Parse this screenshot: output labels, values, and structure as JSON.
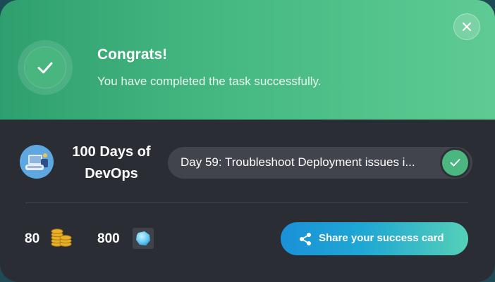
{
  "dialog": {
    "title": "Congrats!",
    "message": "You have completed the task successfully."
  },
  "course": {
    "name": "100 Days of DevOps"
  },
  "task": {
    "label": "Day 59: Troubleshoot Deployment issues i..."
  },
  "stats": {
    "coins": "80",
    "gems": "800"
  },
  "share_button": {
    "label": "Share your success card"
  },
  "colors": {
    "header_start": "#2f9f6f",
    "header_end": "#5fcb94",
    "card_bg": "#2b2d34",
    "pill_bg": "#41444c",
    "check_green": "#4bb67f",
    "share_start": "#1a91d9",
    "share_end": "#55d0b8"
  },
  "icons": {
    "success": "check-icon",
    "close": "close-icon",
    "task_status": "check-icon",
    "coins": "coins-icon",
    "gems": "gem-icon",
    "share": "share-icon"
  }
}
